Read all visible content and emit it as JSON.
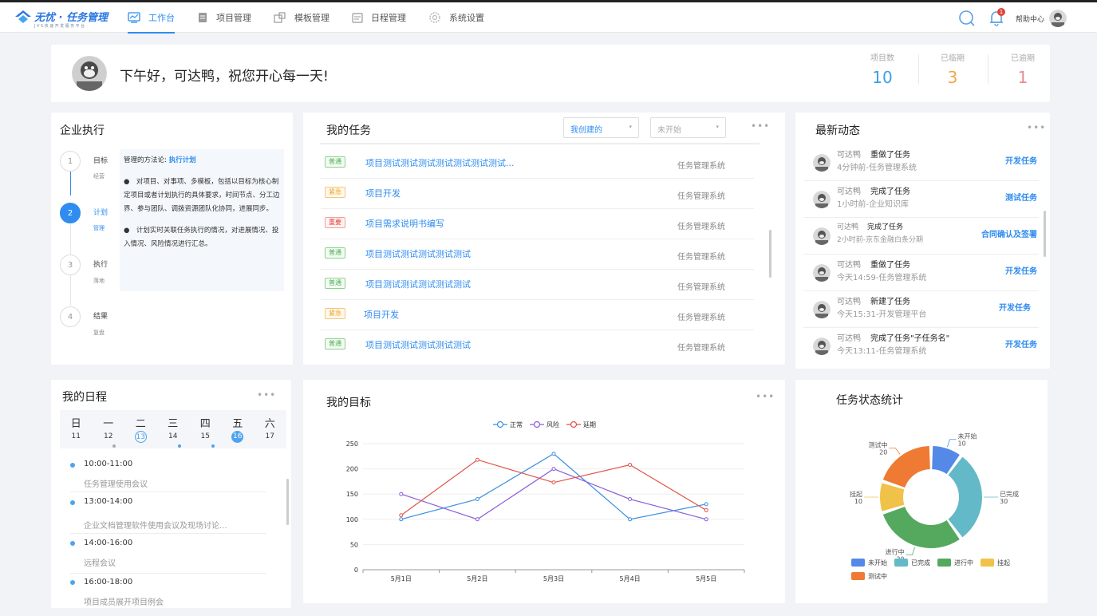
{
  "app": {
    "logo_title": "无忧 · 任务管理",
    "logo_sub": "JVS快速开发服务平台"
  },
  "nav": [
    {
      "label": "工作台",
      "icon": "dashboard-icon"
    },
    {
      "label": "项目管理",
      "icon": "document-icon"
    },
    {
      "label": "模板管理",
      "icon": "template-icon"
    },
    {
      "label": "日程管理",
      "icon": "schedule-icon"
    },
    {
      "label": "系统设置",
      "icon": "settings-icon"
    }
  ],
  "header": {
    "help": "帮助中心",
    "notify_count": "1"
  },
  "welcome": {
    "greeting": "下午好，可达鸭，祝您开心每一天!",
    "stats": [
      {
        "label": "项目数",
        "value": "10",
        "color": "#3c9fe8"
      },
      {
        "label": "已临期",
        "value": "3",
        "color": "#f0a849"
      },
      {
        "label": "已逾期",
        "value": "1",
        "color": "#e98a93"
      }
    ]
  },
  "execution": {
    "title": "企业执行",
    "steps": [
      {
        "num": "1",
        "a": "目标",
        "b": "经营"
      },
      {
        "num": "2",
        "a": "计划",
        "b": "管理"
      },
      {
        "num": "3",
        "a": "执行",
        "b": "落地"
      },
      {
        "num": "4",
        "a": "结果",
        "b": "复盘"
      }
    ],
    "method_prefix": "管理的方法论: ",
    "method_link": "执行计划",
    "para1": "●　对项目、对事项、多模板，包括以目标为核心制定项目或者计划执行的具体要求，时间节点、分工边界、参与团队、调拨资源团队化协同，进展同步。",
    "para2": "●　计划实时关联任务执行的情况，对进展情况、投入情况、风险情况进行汇总。"
  },
  "tasks": {
    "title": "我的任务",
    "filter1": "我创建的",
    "filter2": "未开始",
    "rows": [
      {
        "tag": "普通",
        "tag_class": "g",
        "name": "项目测试测试测试测试测试测试测试...",
        "system": "任务管理系统"
      },
      {
        "tag": "紧急",
        "tag_class": "o",
        "name": "项目开发",
        "system": "任务管理系统"
      },
      {
        "tag": "重要",
        "tag_class": "r",
        "name": "项目需求说明书编写",
        "system": "任务管理系统"
      },
      {
        "tag": "普通",
        "tag_class": "g",
        "name": "项目测试测试测试测试测试",
        "system": "任务管理系统"
      },
      {
        "tag": "普通",
        "tag_class": "g",
        "name": "项目测试测试测试测试测试",
        "system": "任务管理系统"
      },
      {
        "tag": "紧急",
        "tag_class": "o",
        "name": "项目开发",
        "system": "任务管理系统"
      },
      {
        "tag": "普通",
        "tag_class": "g",
        "name": "项目测试测试测试测试测试",
        "system": "任务管理系统"
      }
    ]
  },
  "feed": {
    "title": "最新动态",
    "rows": [
      {
        "user": "可达鸭",
        "action": "重做了任务",
        "time": "4分钟前-任务管理系统",
        "link": "开发任务"
      },
      {
        "user": "可达鸭",
        "action": "完成了任务",
        "time": "1小时前-企业知识库",
        "link": "测试任务"
      },
      {
        "user": "可达鸭",
        "action": "完成了任务",
        "time": "2小时前-京东金融白条分期",
        "link": "合同确认及签署"
      },
      {
        "user": "可达鸭",
        "action": "重做了任务",
        "time": "今天14:59-任务管理系统",
        "link": "开发任务"
      },
      {
        "user": "可达鸭",
        "action": "新建了任务",
        "time": "今天15:31-开发管理平台",
        "link": "开发任务"
      },
      {
        "user": "可达鸭",
        "action": "完成了任务\"子任务名\"",
        "time": "今天13:11-任务管理系统",
        "link": "开发任务"
      }
    ]
  },
  "schedule": {
    "title": "我的日程",
    "weekdays": [
      "日",
      "一",
      "二",
      "三",
      "四",
      "五",
      "六"
    ],
    "dates": [
      "11",
      "12",
      "13",
      "14",
      "15",
      "16",
      "17"
    ],
    "items": [
      {
        "time": "10:00-11:00",
        "desc": "任务管理使用会议"
      },
      {
        "time": "13:00-14:00",
        "desc": "企业文档管理软件使用会议及现场讨论..."
      },
      {
        "time": "14:00-16:00",
        "desc": "远程会议"
      },
      {
        "time": "16:00-18:00",
        "desc": "项目成员展开项目例会"
      }
    ]
  },
  "goals": {
    "title": "我的目标"
  },
  "chart_data": [
    {
      "type": "line",
      "x": [
        "5月1日",
        "5月2日",
        "5月3日",
        "5月4日",
        "5月5日"
      ],
      "ylim": [
        0,
        250
      ],
      "yticks": [
        0,
        50,
        100,
        150,
        200,
        250
      ],
      "series": [
        {
          "name": "正常",
          "color": "#3b8fe0",
          "values": [
            100,
            140,
            230,
            100,
            130
          ]
        },
        {
          "name": "风险",
          "color": "#8a5ed8",
          "values": [
            150,
            100,
            200,
            140,
            100
          ]
        },
        {
          "name": "延期",
          "color": "#e0524a",
          "values": [
            108,
            218,
            173,
            208,
            118
          ]
        }
      ]
    },
    {
      "type": "pie",
      "title": "任务状态统计",
      "series": [
        {
          "name": "未开始",
          "value": 10,
          "color": "#5489e8"
        },
        {
          "name": "已完成",
          "value": 30,
          "color": "#63b9c8"
        },
        {
          "name": "进行中",
          "value": 30,
          "color": "#55a95e"
        },
        {
          "name": "挂起",
          "value": 10,
          "color": "#f1c24a"
        },
        {
          "name": "测试中",
          "value": 20,
          "color": "#ef7a34"
        }
      ]
    }
  ]
}
